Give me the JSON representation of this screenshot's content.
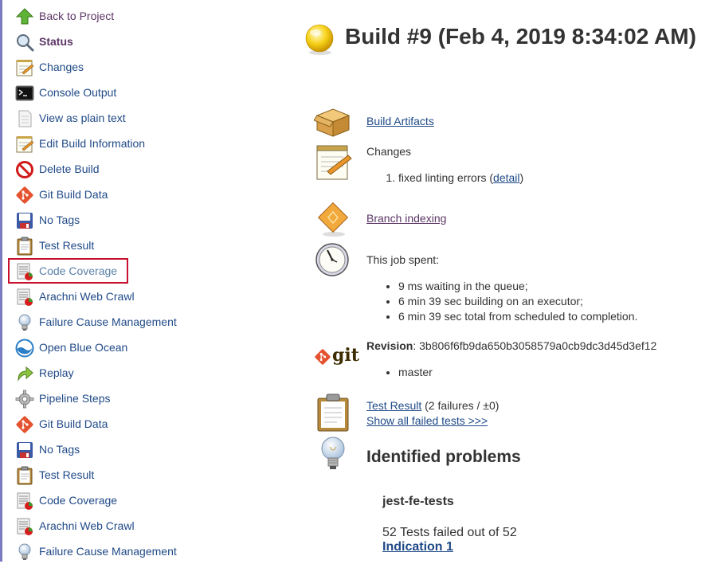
{
  "sidebar": {
    "items": [
      {
        "label": "Back to Project",
        "icon": "up-arrow-icon"
      },
      {
        "label": "Status",
        "icon": "magnifier-icon"
      },
      {
        "label": "Changes",
        "icon": "notepad-icon"
      },
      {
        "label": "Console Output",
        "icon": "terminal-icon"
      },
      {
        "label": "View as plain text",
        "icon": "document-icon"
      },
      {
        "label": "Edit Build Information",
        "icon": "notepad-icon"
      },
      {
        "label": "Delete Build",
        "icon": "no-entry-icon"
      },
      {
        "label": "Git Build Data",
        "icon": "git-icon"
      },
      {
        "label": "No Tags",
        "icon": "floppy-icon"
      },
      {
        "label": "Test Result",
        "icon": "clipboard-icon"
      },
      {
        "label": "Code Coverage",
        "icon": "coverage-report-icon"
      },
      {
        "label": "Arachni Web Crawl",
        "icon": "coverage-report-icon"
      },
      {
        "label": "Failure Cause Management",
        "icon": "lightbulb-icon"
      },
      {
        "label": "Open Blue Ocean",
        "icon": "blue-ocean-icon"
      },
      {
        "label": "Replay",
        "icon": "replay-arrow-icon"
      },
      {
        "label": "Pipeline Steps",
        "icon": "gear-icon"
      },
      {
        "label": "Git Build Data",
        "icon": "git-icon"
      },
      {
        "label": "No Tags",
        "icon": "floppy-icon"
      },
      {
        "label": "Test Result",
        "icon": "clipboard-icon"
      },
      {
        "label": "Code Coverage",
        "icon": "coverage-report-icon"
      },
      {
        "label": "Arachni Web Crawl",
        "icon": "coverage-report-icon"
      },
      {
        "label": "Failure Cause Management",
        "icon": "lightbulb-icon"
      }
    ]
  },
  "build": {
    "title": "Build #9 (Feb 4, 2019 8:34:02 AM)",
    "status_icon": "yellow-ball-icon"
  },
  "artifacts": {
    "label": "Build Artifacts"
  },
  "changes": {
    "heading": "Changes",
    "item_text": "fixed linting errors (",
    "detail_link": "detail",
    "item_close": ")"
  },
  "branch_indexing": {
    "label": "Branch indexing"
  },
  "timing": {
    "heading": "This job spent:",
    "items": [
      "9 ms waiting in the queue;",
      "6 min 39 sec building on an executor;",
      "6 min 39 sec total from scheduled to completion."
    ]
  },
  "revision": {
    "logo_text": "git",
    "label": "Revision",
    "sep": ": ",
    "hash": "3b806f6fb9da650b3058579a0cb9dc3d45d3ef12",
    "branch": "master"
  },
  "test_result": {
    "link": "Test Result",
    "summary": " (2 failures / ±0)",
    "show_failed": "Show all failed tests >>>"
  },
  "problems": {
    "heading": "Identified problems",
    "job": "jest-fe-tests",
    "failed_text": "52 Tests failed out of 52",
    "indication": "Indication 1"
  },
  "colors": {
    "link": "#204a87",
    "visited": "#5c3566",
    "highlight_border": "#c8102e"
  }
}
